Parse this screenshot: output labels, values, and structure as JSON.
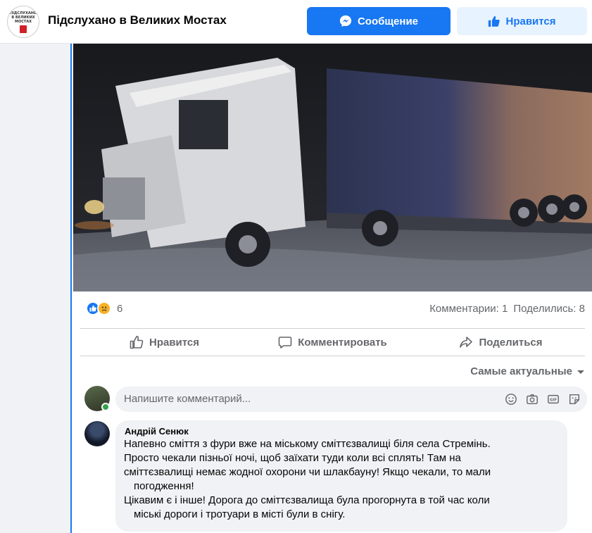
{
  "page": {
    "name": "Підслухано в Великих Мостах",
    "avatar_label": "ПІДСЛУХАНО В ВЕЛИКИХ МОСТАХ"
  },
  "header_buttons": {
    "message_label": "Сообщение",
    "like_label": "Нравится"
  },
  "post": {
    "image_alt": "truck-at-night",
    "reaction_count": "6",
    "comments_count": "Комментарии: 1",
    "shares_count": "Поделились: 8"
  },
  "actions": {
    "like": "Нравится",
    "comment": "Комментировать",
    "share": "Поделиться"
  },
  "comments_sort": "Самые актуальные",
  "composer": {
    "placeholder": "Напишите комментарий..."
  },
  "comment": {
    "author": "Андрій Сенюк",
    "lines": [
      "Напевно сміття з фури вже на міському сміттєзвалищі біля села Стремінь.",
      "Просто чекали пізньої ночі, щоб заїхати туди коли всі сплять! Там на",
      "сміттєзвалищі немає жодної охорони чи шлакбауну! Якщо чекали, то мали",
      "погодження!",
      "Цікавим є і інше! Дорога до сміттєзвалища була прогорнута в той час коли",
      "міські дороги і тротуари в місті були в снігу."
    ]
  },
  "colors": {
    "brand_blue": "#1877f2",
    "secondary_text": "#65676b",
    "bubble_bg": "#f0f2f5",
    "online": "#31a24c"
  },
  "icons": [
    "messenger-icon",
    "thumbs-up-icon",
    "like-reaction-icon",
    "sad-reaction-icon",
    "comment-icon",
    "share-icon",
    "caret-down-icon",
    "emoji-icon",
    "camera-icon",
    "gif-icon",
    "sticker-icon"
  ]
}
